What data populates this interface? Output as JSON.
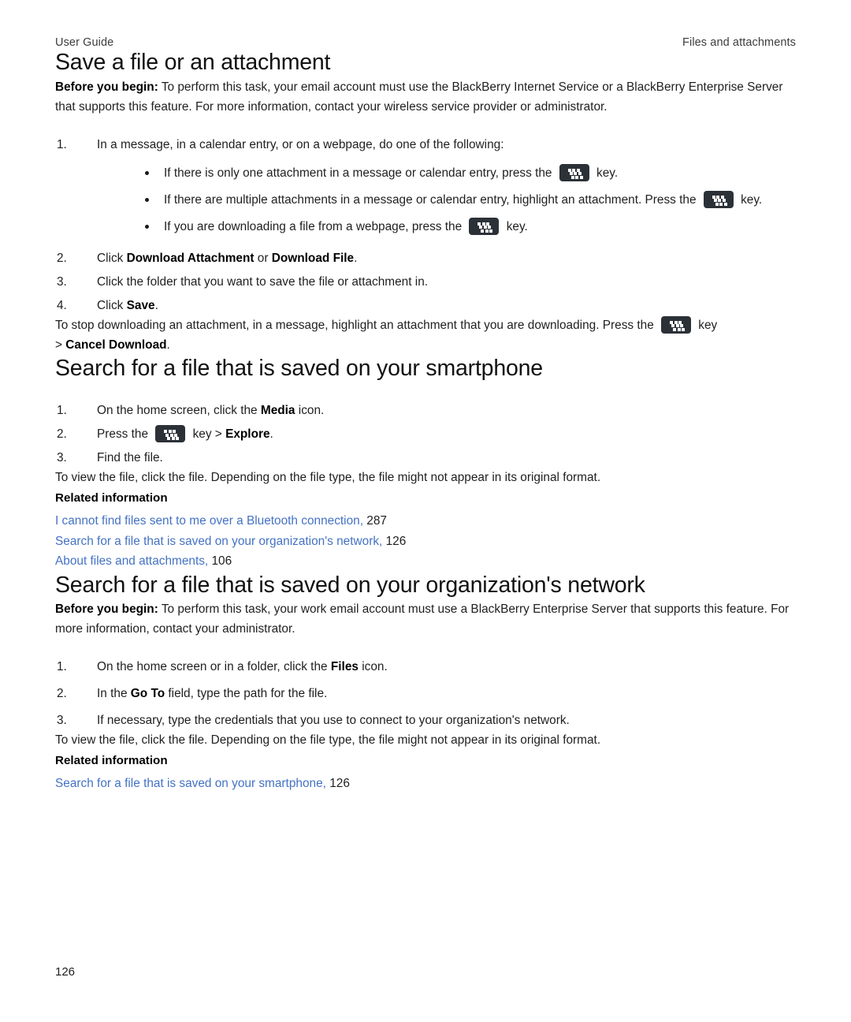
{
  "header": {
    "left": "User Guide",
    "right": "Files and attachments"
  },
  "icons": {
    "menu_key": "blackberry-menu-key-icon"
  },
  "sections": [
    {
      "id": "save-a-file",
      "title": "Save a file or an attachment",
      "before_you_begin_label": "Before you begin:",
      "before_you_begin_text": " To perform this task, your email account must use the BlackBerry Internet Service or a BlackBerry Enterprise Server that supports this feature. For more information, contact your wireless service provider or administrator.",
      "steps": [
        {
          "num": "1.",
          "text": "In a message, in a calendar entry, or on a webpage, do one of the following:"
        },
        {
          "num": "2.",
          "text_pre": "Click ",
          "bold1": "Download Attachment",
          "text_mid": " or ",
          "bold2": "Download File",
          "text_post": "."
        },
        {
          "num": "3.",
          "text": "Click the folder that you want to save the file or attachment in."
        },
        {
          "num": "4.",
          "text_pre": "Click ",
          "bold1": "Save",
          "text_post": "."
        }
      ],
      "bullets": [
        {
          "pre": "If there is only one attachment in a message or calendar entry, press the ",
          "post": " key."
        },
        {
          "pre": "If there are multiple attachments in a message or calendar entry, highlight an attachment. Press the ",
          "post": " key."
        },
        {
          "pre": "If you are downloading a file from a webpage, press the ",
          "post": " key."
        }
      ],
      "stop_para_pre": "To stop downloading an attachment, in a message, highlight an attachment that you are downloading. Press the ",
      "stop_para_post": " key",
      "stop_para_line2_pre": "> ",
      "stop_para_line2_bold": "Cancel Download",
      "stop_para_line2_post": "."
    },
    {
      "id": "search-smartphone",
      "title": "Search for a file that is saved on your smartphone",
      "steps": [
        {
          "num": "1.",
          "text_pre": "On the home screen, click the ",
          "bold1": "Media",
          "text_post": " icon."
        },
        {
          "num": "2.",
          "text_pre": "Press the ",
          "text_mid": " key > ",
          "bold1": "Explore",
          "text_post": "."
        },
        {
          "num": "3.",
          "text": "Find the file."
        }
      ],
      "view_para": "To view the file, click the file. Depending on the file type, the file might not appear in its original format.",
      "related_label": "Related information",
      "related": [
        {
          "link": "I cannot find files sent to me over a Bluetooth connection,",
          "page": "287"
        },
        {
          "link": "Search for a file that is saved on your organization's network,",
          "page": "126"
        },
        {
          "link": "About files and attachments,",
          "page": "106"
        }
      ]
    },
    {
      "id": "search-organization",
      "title": "Search for a file that is saved on your organization's network",
      "before_you_begin_label": "Before you begin:",
      "before_you_begin_text": " To perform this task, your work email account must use a BlackBerry Enterprise Server that supports this feature. For more information, contact your administrator.",
      "steps": [
        {
          "num": "1.",
          "text_pre": "On the home screen or in a folder, click the ",
          "bold1": "Files",
          "text_post": " icon."
        },
        {
          "num": "2.",
          "text_pre": "In the ",
          "bold1": "Go To",
          "text_post": " field, type the path for the file."
        },
        {
          "num": "3.",
          "text": "If necessary, type the credentials that you use to connect to your organization's network."
        }
      ],
      "view_para": "To view the file, click the file. Depending on the file type, the file might not appear in its original format.",
      "related_label": "Related information",
      "related": [
        {
          "link": "Search for a file that is saved on your smartphone,",
          "page": "126"
        }
      ]
    }
  ],
  "footer": {
    "page_number": "126"
  },
  "colors": {
    "link": "#4472c4",
    "key_icon_bg": "#2b3137",
    "text": "#1f1f1f"
  }
}
